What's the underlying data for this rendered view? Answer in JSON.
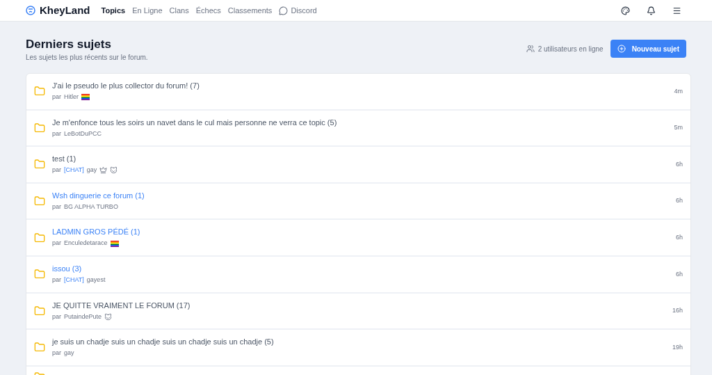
{
  "navbar": {
    "brand": "KheyLand",
    "links": [
      {
        "label": "Topics",
        "selected": true
      },
      {
        "label": "En Ligne",
        "selected": false
      },
      {
        "label": "Clans",
        "selected": false
      },
      {
        "label": "Échecs",
        "selected": false
      },
      {
        "label": "Classements",
        "selected": false
      },
      {
        "label": "Discord",
        "selected": false,
        "kind": "chat"
      }
    ]
  },
  "header": {
    "title": "Derniers sujets",
    "subtitle": "Les sujets les plus récents sur le forum.",
    "online": "2 utilisateurs en ligne",
    "new_button": "Nouveau sujet"
  },
  "topics": [
    {
      "title": "J'ai le pseudo le plus collector du forum! (7)",
      "unread": false,
      "by": "par",
      "author": "Hitler",
      "badges": [
        {
          "kind": "flag"
        }
      ],
      "time": "4m"
    },
    {
      "title": "Je m'enfonce tous les soirs un navet dans le cul mais personne ne verra ce topic (5)",
      "unread": false,
      "by": "par",
      "author": "LeBotDuPCC",
      "time": "5m"
    },
    {
      "title": "test (1)",
      "unread": false,
      "by": "par",
      "tag": "[CHAT]",
      "author": "gay",
      "badges": [
        {
          "kind": "crown"
        },
        {
          "kind": "cat"
        }
      ],
      "time": "6h"
    },
    {
      "title": "Wsh dinguerie ce forum (1)",
      "unread": true,
      "by": "par",
      "author": "BG ALPHA TURBO",
      "time": "6h"
    },
    {
      "title": "LADMIN GROS PÉDÉ (1)",
      "unread": true,
      "by": "par",
      "author": "Enculedetarace",
      "badges": [
        {
          "kind": "flag"
        }
      ],
      "time": "6h"
    },
    {
      "title": "issou (3)",
      "unread": true,
      "by": "par",
      "tag": "[CHAT]",
      "author": "gayest",
      "time": "6h"
    },
    {
      "title": "JE QUITTE VRAIMENT LE FORUM (17)",
      "unread": false,
      "by": "par",
      "author": "PutaindePute",
      "badges": [
        {
          "kind": "cat"
        }
      ],
      "time": "16h"
    },
    {
      "title": "je suis un chadje suis un chadje suis un chadje suis un chadje (5)",
      "unread": false,
      "by": "par",
      "author": "gay",
      "time": "19h"
    }
  ]
}
